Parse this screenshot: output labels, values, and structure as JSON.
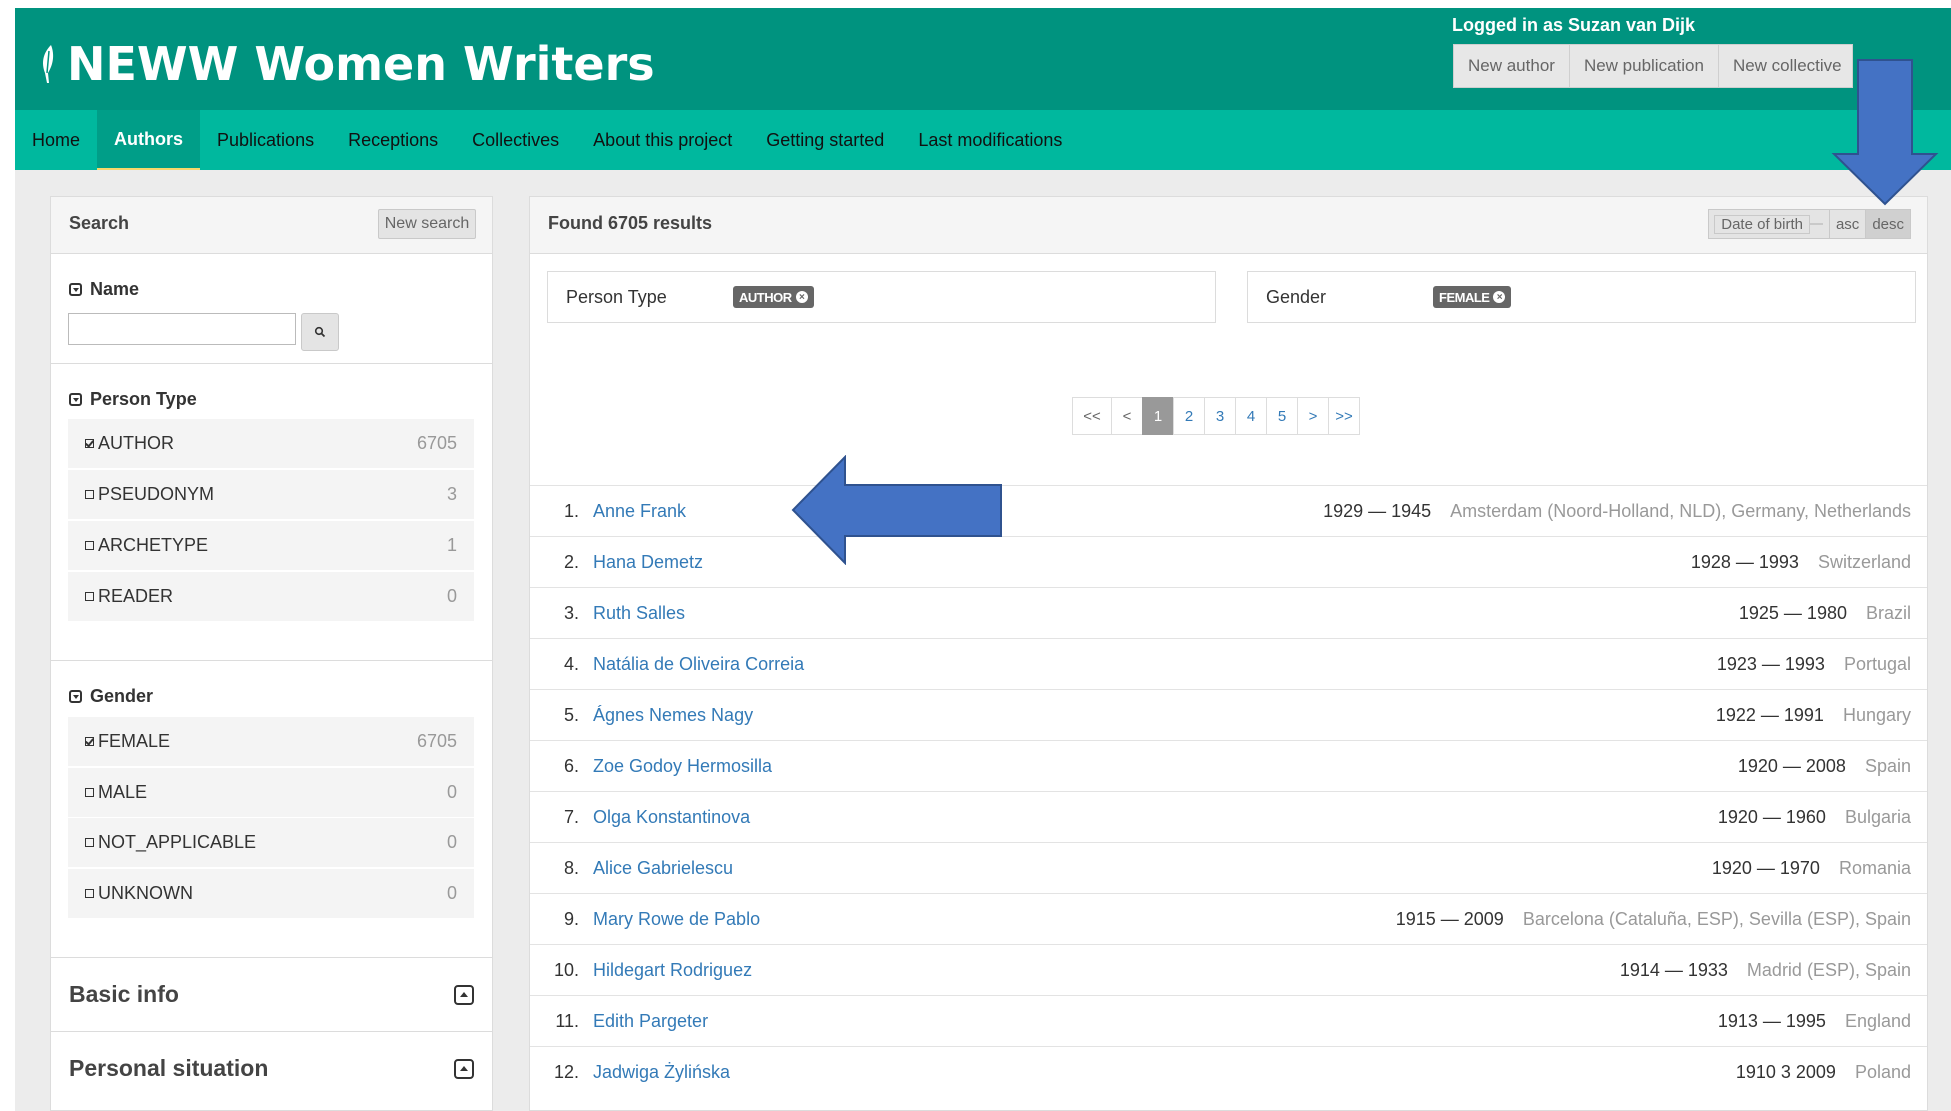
{
  "header": {
    "brand": "NEWW Women Writers",
    "login": "Logged in as Suzan van Dijk",
    "buttons": [
      "New author",
      "New publication",
      "New collective"
    ]
  },
  "nav": [
    "Home",
    "Authors",
    "Publications",
    "Receptions",
    "Collectives",
    "About this project",
    "Getting started",
    "Last modifications"
  ],
  "nav_active": "Authors",
  "sidebar": {
    "title": "Search",
    "new_search": "New search",
    "name_title": "Name",
    "person_type_title": "Person Type",
    "person_types": [
      {
        "label": "AUTHOR",
        "count": "6705",
        "checked": true
      },
      {
        "label": "PSEUDONYM",
        "count": "3",
        "checked": false
      },
      {
        "label": "ARCHETYPE",
        "count": "1",
        "checked": false
      },
      {
        "label": "READER",
        "count": "0",
        "checked": false
      }
    ],
    "gender_title": "Gender",
    "genders": [
      {
        "label": "FEMALE",
        "count": "6705",
        "checked": true
      },
      {
        "label": "MALE",
        "count": "0",
        "checked": false
      },
      {
        "label": "NOT_APPLICABLE",
        "count": "0",
        "checked": false
      },
      {
        "label": "UNKNOWN",
        "count": "0",
        "checked": false
      }
    ],
    "basic_info": "Basic info",
    "personal_situation": "Personal situation"
  },
  "main": {
    "found": "Found 6705 results",
    "sort_field": "Date of birth",
    "sort_asc": "asc",
    "sort_desc": "desc",
    "filters": [
      {
        "label": "Person Type",
        "badge": "AUTHOR"
      },
      {
        "label": "Gender",
        "badge": "FEMALE"
      }
    ],
    "pager": [
      "<<",
      "<",
      "1",
      "2",
      "3",
      "4",
      "5",
      ">",
      ">>"
    ],
    "pager_current": "1",
    "results": [
      {
        "num": "1.",
        "name": "Anne Frank",
        "years": "1929 — 1945",
        "place": "Amsterdam (Noord-Holland, NLD), Germany, Netherlands"
      },
      {
        "num": "2.",
        "name": "Hana Demetz",
        "years": "1928 — 1993",
        "place": "Switzerland"
      },
      {
        "num": "3.",
        "name": "Ruth Salles",
        "years": "1925 — 1980",
        "place": "Brazil"
      },
      {
        "num": "4.",
        "name": "Natália de Oliveira Correia",
        "years": "1923 — 1993",
        "place": "Portugal"
      },
      {
        "num": "5.",
        "name": "Ágnes Nemes Nagy",
        "years": "1922 — 1991",
        "place": "Hungary"
      },
      {
        "num": "6.",
        "name": "Zoe Godoy Hermosilla",
        "years": "1920 — 2008",
        "place": "Spain"
      },
      {
        "num": "7.",
        "name": "Olga Konstantinova",
        "years": "1920 — 1960",
        "place": "Bulgaria"
      },
      {
        "num": "8.",
        "name": "Alice Gabrielescu",
        "years": "1920 — 1970",
        "place": "Romania"
      },
      {
        "num": "9.",
        "name": "Mary Rowe de Pablo",
        "years": "1915 — 2009",
        "place": "Barcelona (Cataluña, ESP), Sevilla (ESP), Spain"
      },
      {
        "num": "10.",
        "name": "Hildegart Rodriguez",
        "years": "1914 — 1933",
        "place": "Madrid (ESP), Spain"
      },
      {
        "num": "11.",
        "name": "Edith Pargeter",
        "years": "1913 — 1995",
        "place": "England"
      },
      {
        "num": "12.",
        "name": "Jadwiga Żylińska",
        "years": "1910 3 2009",
        "place": "Poland"
      }
    ]
  },
  "colors": {
    "header": "#00937f",
    "nav": "#00b89e",
    "arrow": "#4472c4",
    "link": "#337ab7"
  }
}
